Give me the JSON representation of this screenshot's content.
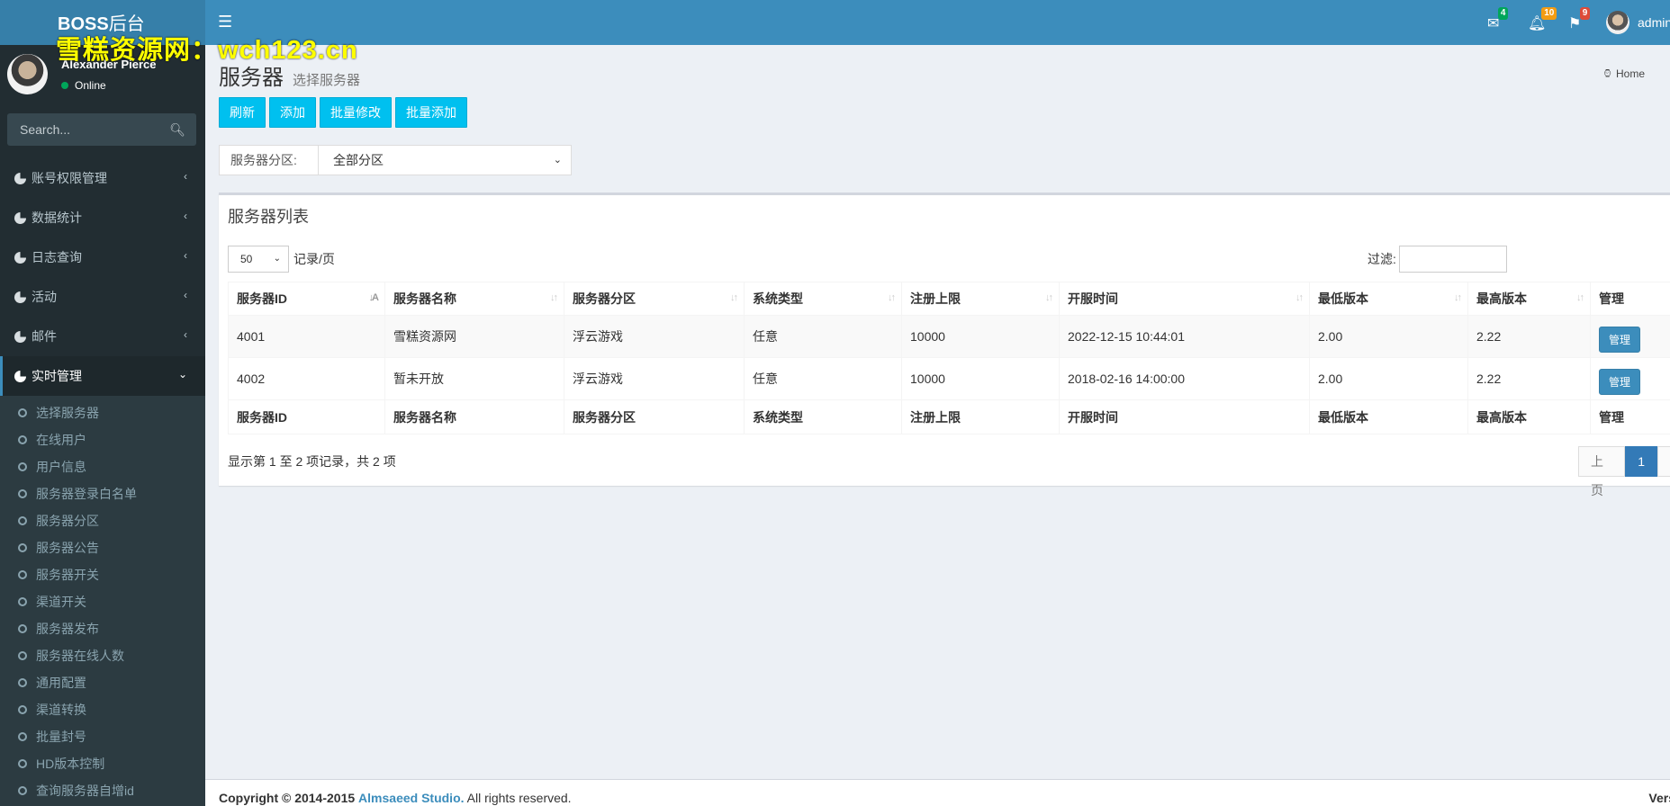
{
  "header": {
    "logo_bold": "BOSS",
    "logo_light": "后台",
    "watermark": "雪糕资源网：wch123.cn",
    "messages_count": "4",
    "notifications_count": "10",
    "tasks_count": "9",
    "user_label": "admin",
    "badge_colors": {
      "messages": "#00a65a",
      "notifications": "#f39c12",
      "tasks": "#dd4b39"
    }
  },
  "sidebar": {
    "user_name": "Alexander Pierce",
    "user_status": "Online",
    "search_placeholder": "Search...",
    "menu": [
      {
        "label": "账号权限管理"
      },
      {
        "label": "数据统计"
      },
      {
        "label": "日志查询"
      },
      {
        "label": "活动"
      },
      {
        "label": "邮件"
      },
      {
        "label": "实时管理"
      }
    ],
    "submenu": [
      {
        "label": "选择服务器"
      },
      {
        "label": "在线用户"
      },
      {
        "label": "用户信息"
      },
      {
        "label": "服务器登录白名单"
      },
      {
        "label": "服务器分区"
      },
      {
        "label": "服务器公告"
      },
      {
        "label": "服务器开关"
      },
      {
        "label": "渠道开关"
      },
      {
        "label": "服务器发布"
      },
      {
        "label": "服务器在线人数"
      },
      {
        "label": "通用配置"
      },
      {
        "label": "渠道转换"
      },
      {
        "label": "批量封号"
      },
      {
        "label": "HD版本控制"
      },
      {
        "label": "查询服务器自增id"
      }
    ]
  },
  "page": {
    "title": "服务器",
    "subtitle": "选择服务器",
    "breadcrumb_home": "Home",
    "buttons": {
      "refresh": "刷新",
      "add": "添加",
      "batch_edit": "批量修改",
      "batch_add": "批量添加"
    },
    "partition_label": "服务器分区:",
    "partition_value": "全部分区"
  },
  "table_box": {
    "title": "服务器列表",
    "page_length": "50",
    "page_length_suffix": "记录/页",
    "filter_label": "过滤:",
    "filter_value": "",
    "columns": [
      "服务器ID",
      "服务器名称",
      "服务器分区",
      "系统类型",
      "注册上限",
      "开服时间",
      "最低版本",
      "最高版本",
      "管理"
    ],
    "rows": [
      {
        "id": "4001",
        "name": "雪糕资源网",
        "partition": "浮云游戏",
        "os": "任意",
        "reg_limit": "10000",
        "open_time": "2022-12-15 10:44:01",
        "min_ver": "2.00",
        "max_ver": "2.22",
        "action": "管理"
      },
      {
        "id": "4002",
        "name": "暂未开放",
        "partition": "浮云游戏",
        "os": "任意",
        "reg_limit": "10000",
        "open_time": "2018-02-16 14:00:00",
        "min_ver": "2.00",
        "max_ver": "2.22",
        "action": "管理"
      }
    ],
    "info": "显示第 1 至 2 项记录，共 2 项",
    "pager": {
      "prev": "上页",
      "current": "1"
    }
  },
  "footer": {
    "copyright": "Copyright © 2014-2015",
    "company": "Almsaeed Studio.",
    "rights": "All rights reserved.",
    "version": "Vers"
  }
}
